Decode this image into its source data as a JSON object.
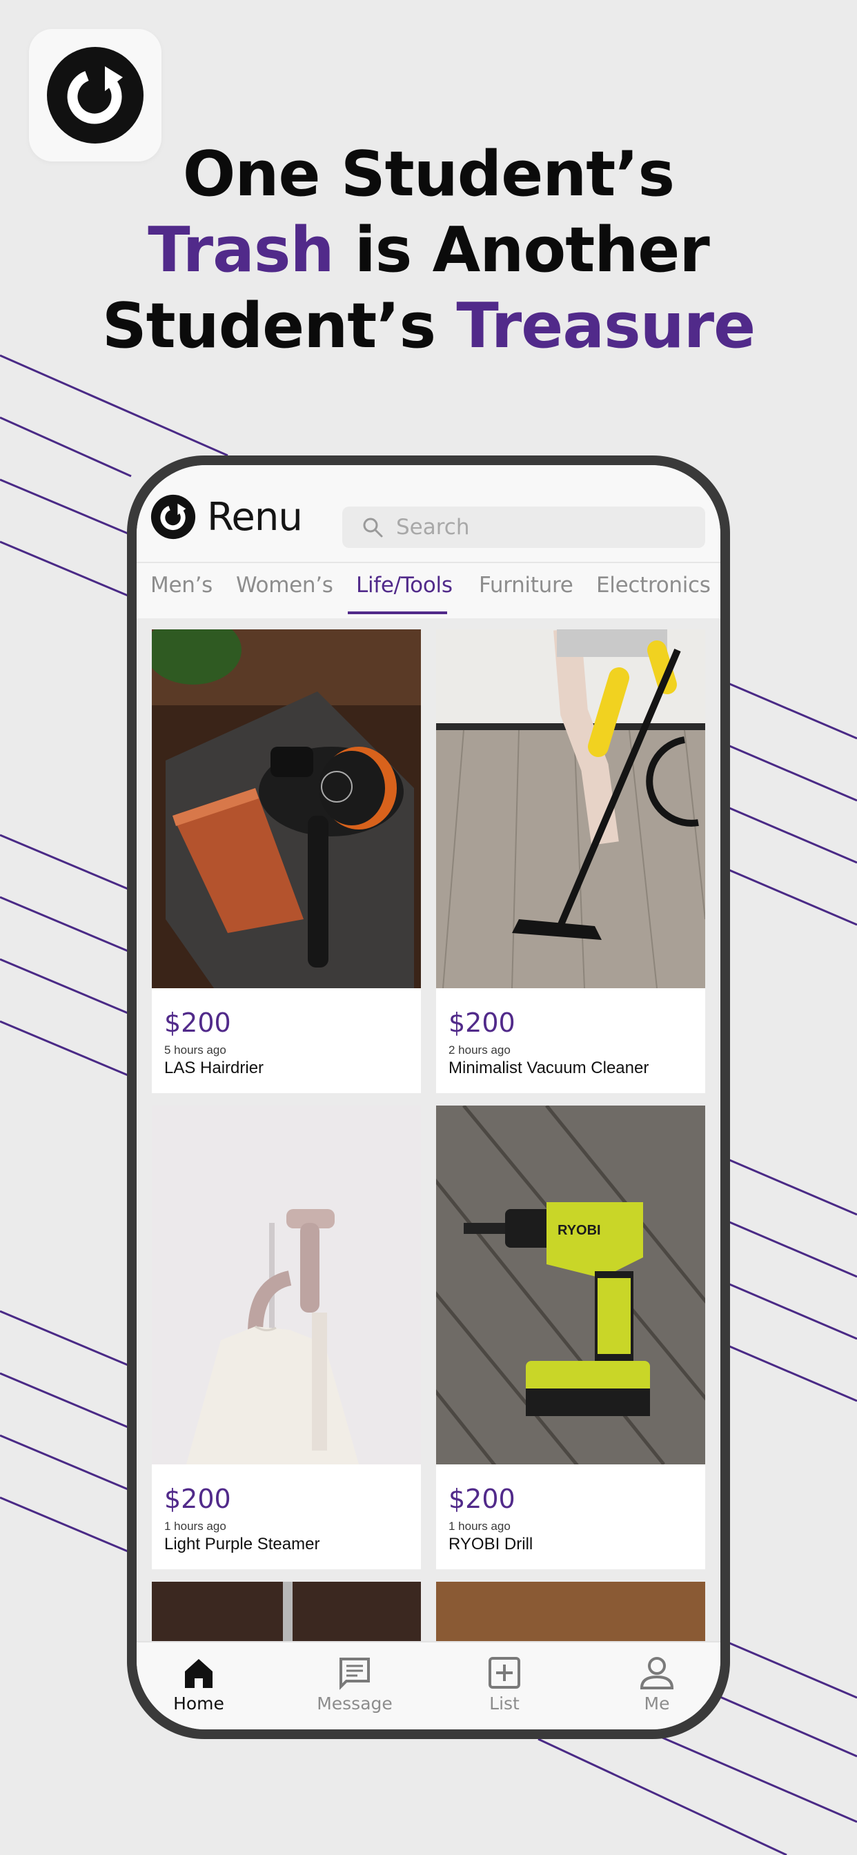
{
  "headline": {
    "line1": "One Student’s",
    "line2_accent": "Trash",
    "line2_rest": " is Another",
    "line3_start": "Student’s ",
    "line3_accent": "Treasure"
  },
  "colors": {
    "accent": "#512a8a",
    "text": "#0b0b0b",
    "muted": "#8d8d8d",
    "background": "#ebebeb"
  },
  "app": {
    "name": "Renu",
    "logo_icon": "renew-arrow-icon",
    "search": {
      "placeholder": "Search",
      "icon": "search-icon"
    }
  },
  "tabs": [
    {
      "label": "Men’s",
      "active": false
    },
    {
      "label": "Women’s",
      "active": false
    },
    {
      "label": "Life/Tools",
      "active": true
    },
    {
      "label": "Furniture",
      "active": false
    },
    {
      "label": "Electronics",
      "active": false
    }
  ],
  "listings": [
    {
      "price": "$200",
      "time": "5 hours ago",
      "title": "LAS Hairdrier"
    },
    {
      "price": "$200",
      "time": "2 hours ago",
      "title": "Minimalist Vacuum Cleaner"
    },
    {
      "price": "$200",
      "time": "1 hours ago",
      "title": "Light Purple Steamer"
    },
    {
      "price": "$200",
      "time": "1 hours ago",
      "title": "RYOBI Drill"
    }
  ],
  "photo_labels": {
    "drill_brand": "RYOBI"
  },
  "bottom_nav": [
    {
      "label": "Home",
      "icon": "home-icon",
      "active": true
    },
    {
      "label": "Message",
      "icon": "message-icon",
      "active": false
    },
    {
      "label": "List",
      "icon": "add-listing-icon",
      "active": false
    },
    {
      "label": "Me",
      "icon": "profile-icon",
      "active": false
    }
  ]
}
